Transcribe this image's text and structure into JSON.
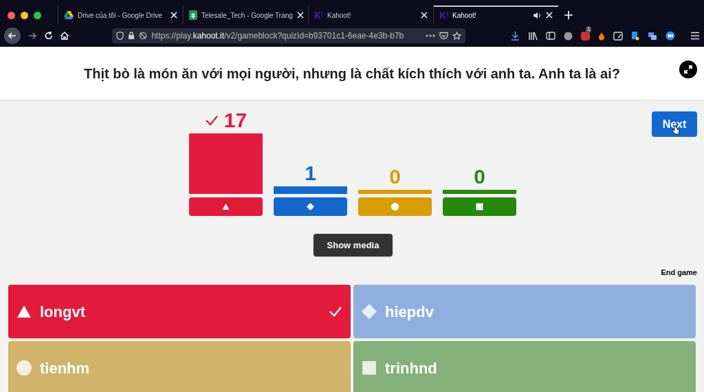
{
  "browser": {
    "tabs": [
      {
        "title": "Drive của tôi - Google Drive",
        "selected": false,
        "audio": false
      },
      {
        "title": "Telesale_Tech - Google Trang",
        "selected": false,
        "audio": false
      },
      {
        "title": "Kahoot!",
        "selected": false,
        "audio": false
      },
      {
        "title": "Kahoot!",
        "selected": true,
        "audio": true
      }
    ],
    "url": {
      "prefix": "https://play.",
      "domain": "kahoot.it",
      "path": "/v2/gameblock?quizId=b93701c1-6eae-4e3b-b7b"
    },
    "extension_badge": "1"
  },
  "question": "Thịt bò là món ăn với mọi người, nhưng là chất kích thích với anh ta. Anh ta là ai?",
  "next_button": "Next",
  "results": [
    {
      "kind": "triangle",
      "count": "17",
      "correct": true
    },
    {
      "kind": "diamond",
      "count": "1",
      "correct": false
    },
    {
      "kind": "circle",
      "count": "0",
      "correct": false
    },
    {
      "kind": "square",
      "count": "0",
      "correct": false
    }
  ],
  "show_media_button": "Show media",
  "end_game_link": "End game",
  "answers": [
    {
      "kind": "triangle",
      "label": "longvt",
      "correct": true
    },
    {
      "kind": "diamond",
      "label": "hiepdv",
      "correct": false
    },
    {
      "kind": "circle",
      "label": "tienhm",
      "correct": false
    },
    {
      "kind": "square",
      "label": "trinhnd",
      "correct": false
    }
  ]
}
